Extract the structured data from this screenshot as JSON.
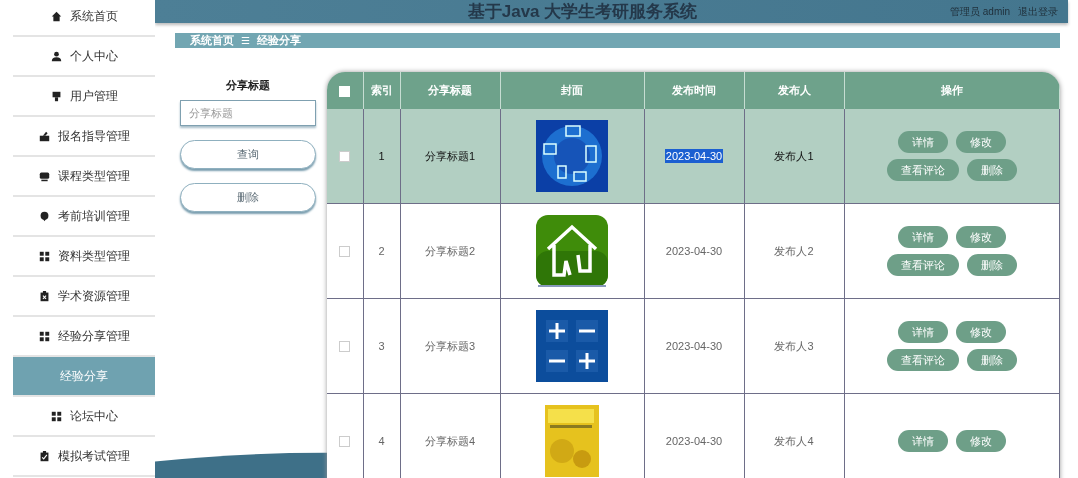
{
  "header": {
    "title": "基于Java 大学生考研服务系统",
    "user": "管理员 admin",
    "logout": "退出登录"
  },
  "sidebar": {
    "items": [
      {
        "label": "系统首页",
        "selected": false
      },
      {
        "label": "个人中心",
        "selected": false
      },
      {
        "label": "用户管理",
        "selected": false
      },
      {
        "label": "报名指导管理",
        "selected": false
      },
      {
        "label": "课程类型管理",
        "selected": false
      },
      {
        "label": "考前培训管理",
        "selected": false
      },
      {
        "label": "资料类型管理",
        "selected": false
      },
      {
        "label": "学术资源管理",
        "selected": false
      },
      {
        "label": "经验分享管理",
        "selected": false,
        "expanded": true,
        "children": [
          {
            "label": "经验分享",
            "selected": true
          }
        ]
      },
      {
        "label": "论坛中心",
        "selected": false
      },
      {
        "label": "模拟考试管理",
        "selected": false
      }
    ]
  },
  "breadcrumb": {
    "items": [
      "系统首页",
      "经验分享"
    ],
    "separator": "☰"
  },
  "search": {
    "label": "分享标题",
    "placeholder": "分享标题",
    "buttons": [
      "查询",
      "删除"
    ]
  },
  "table": {
    "select_all_checked": false,
    "columns": [
      "索引",
      "分享标题",
      "封面",
      "发布时间",
      "发布人",
      "操作"
    ],
    "rows": [
      {
        "selected": true,
        "checked": false,
        "index": "1",
        "title": "分享标题1",
        "time": "2023-04-30",
        "time_highlighted": true,
        "publisher": "发布人1",
        "actions": [
          "详情",
          "修改",
          "查看评论",
          "删除"
        ]
      },
      {
        "selected": false,
        "checked": false,
        "index": "2",
        "title": "分享标题2",
        "time": "2023-04-30",
        "time_highlighted": false,
        "publisher": "发布人2",
        "actions": [
          "详情",
          "修改",
          "查看评论",
          "删除"
        ]
      },
      {
        "selected": false,
        "checked": false,
        "index": "3",
        "title": "分享标题3",
        "time": "2023-04-30",
        "time_highlighted": false,
        "publisher": "发布人3",
        "actions": [
          "详情",
          "修改",
          "查看评论",
          "删除"
        ]
      },
      {
        "selected": false,
        "checked": false,
        "index": "4",
        "title": "分享标题4",
        "time": "2023-04-30",
        "time_highlighted": false,
        "publisher": "发布人4",
        "actions": [
          "详情",
          "修改"
        ]
      }
    ]
  }
}
